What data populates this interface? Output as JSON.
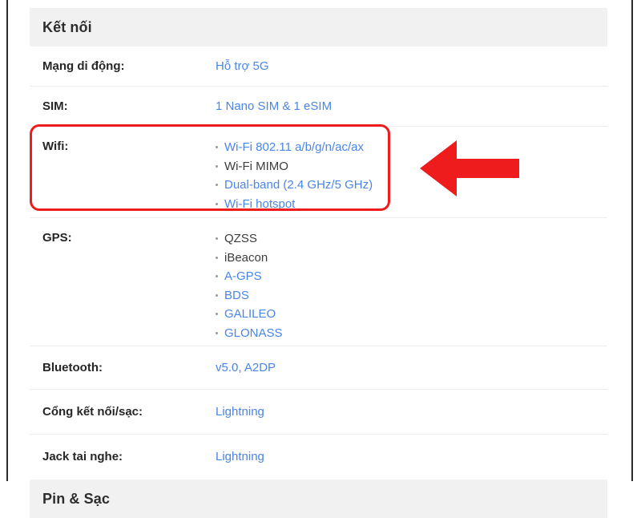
{
  "page": {
    "accent_link_color": "#4a85e8",
    "text_color": "#3c3c3c",
    "header_bg": "#f1f1f1",
    "annotation_color": "#ee1c1c"
  },
  "sections": {
    "connectivity": {
      "title": "Kết nối"
    },
    "battery": {
      "title": "Pin & Sạc"
    }
  },
  "rows": {
    "mobile_network": {
      "label": "Mạng di động:",
      "value": "Hỗ trợ 5G"
    },
    "sim": {
      "label": "SIM:",
      "value": "1 Nano SIM & 1 eSIM"
    },
    "wifi": {
      "label": "Wifi:",
      "items": [
        {
          "text": "Wi-Fi 802.11 a/b/g/n/ac/ax",
          "link": true
        },
        {
          "text": "Wi-Fi MIMO",
          "link": false
        },
        {
          "text": "Dual-band (2.4 GHz/5 GHz)",
          "link": true
        },
        {
          "text": "Wi-Fi hotspot",
          "link": true
        }
      ]
    },
    "gps": {
      "label": "GPS:",
      "items": [
        {
          "text": "QZSS",
          "link": false
        },
        {
          "text": "iBeacon",
          "link": false
        },
        {
          "text": "A-GPS",
          "link": true
        },
        {
          "text": "BDS",
          "link": true
        },
        {
          "text": "GALILEO",
          "link": true
        },
        {
          "text": "GLONASS",
          "link": true
        }
      ]
    },
    "bluetooth": {
      "label": "Bluetooth:",
      "value": "v5.0, A2DP"
    },
    "charging_port": {
      "label": "Cổng kết nối/sạc:",
      "value": "Lightning"
    },
    "headphone_jack": {
      "label": "Jack tai nghe:",
      "value": "Lightning"
    }
  },
  "annotations": {
    "highlight_box": {
      "name": "wifi-row-highlight",
      "color": "#ee1c1c"
    },
    "arrow": {
      "name": "left-pointing-arrow",
      "direction": "left",
      "color": "#ee1c1c"
    }
  }
}
